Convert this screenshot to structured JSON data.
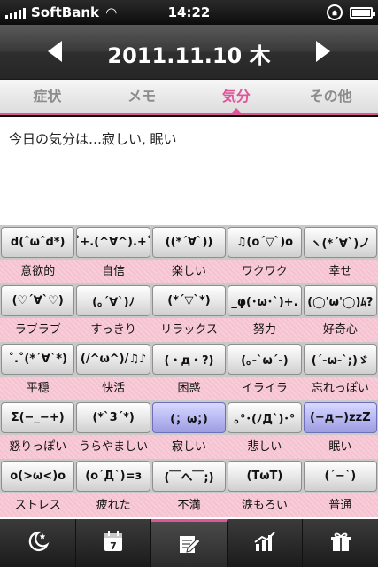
{
  "status_bar": {
    "carrier": "SoftBank",
    "time": "14:22"
  },
  "header": {
    "date": "2011.11.10 木"
  },
  "tabs": [
    {
      "label": "症状",
      "active": false
    },
    {
      "label": "メモ",
      "active": false
    },
    {
      "label": "気分",
      "active": true
    },
    {
      "label": "その他",
      "active": false
    }
  ],
  "note": {
    "text": "今日の気分は…寂しい, 眠い"
  },
  "moods": [
    [
      {
        "face": "d(ˆωˆd*)",
        "label": "意欲的"
      },
      {
        "face": "˚+.(^∀^).+˚",
        "label": "自信"
      },
      {
        "face": "((*´∀`))",
        "label": "楽しい"
      },
      {
        "face": "♫(o´▽`)o",
        "label": "ワクワク"
      },
      {
        "face": "ヽ(*´∀`)ノ",
        "label": "幸せ"
      }
    ],
    [
      {
        "face": "(♡´∀`♡)",
        "label": "ラブラブ"
      },
      {
        "face": "(｡´∀`)ﾉ",
        "label": "すっきり"
      },
      {
        "face": "(*´▽`*)",
        "label": "リラックス"
      },
      {
        "face": "_φ(･ω･`)+.",
        "label": "努力"
      },
      {
        "face": "(◯'ω'◯)ﾑ?",
        "label": "好奇心"
      }
    ],
    [
      {
        "face": "˚.˚(*´∀`*)",
        "label": "平穏"
      },
      {
        "face": "(/^ω^)/♫♪",
        "label": "快活"
      },
      {
        "face": "(・д・?)",
        "label": "困惑"
      },
      {
        "face": "(｡-`ω´-)",
        "label": "イライラ"
      },
      {
        "face": "(´-ω-`;)ゞ",
        "label": "忘れっぽい"
      }
    ],
    [
      {
        "face": "Σ(−_−+)",
        "label": "怒りっぽい"
      },
      {
        "face": "(*`3´*)",
        "label": "うらやましい"
      },
      {
        "face": "(；ω；)",
        "label": "寂しい",
        "selected": true
      },
      {
        "face": "｡°･(ﾉД`)･°",
        "label": "悲しい"
      },
      {
        "face": "(−д−)zzZ",
        "label": "眠い",
        "selected": true
      }
    ],
    [
      {
        "face": "o(>ω<)o",
        "label": "ストレス"
      },
      {
        "face": "(o´Д`)=з",
        "label": "疲れた"
      },
      {
        "face": "(￣へ￣;)",
        "label": "不満"
      },
      {
        "face": "(TωT)",
        "label": "涙もろい"
      },
      {
        "face": "(´−`)",
        "label": "普通"
      }
    ]
  ],
  "toolbar": [
    {
      "icon": "moon-star-icon",
      "active": false
    },
    {
      "icon": "calendar-icon",
      "active": false,
      "day": "7"
    },
    {
      "icon": "memo-pencil-icon",
      "active": true
    },
    {
      "icon": "bar-chart-icon",
      "active": false
    },
    {
      "icon": "gift-icon",
      "active": false
    }
  ],
  "colors": {
    "accent": "#e0559a",
    "label_bg": "#f6c2d2",
    "selected_button": "#b7b7f2"
  }
}
